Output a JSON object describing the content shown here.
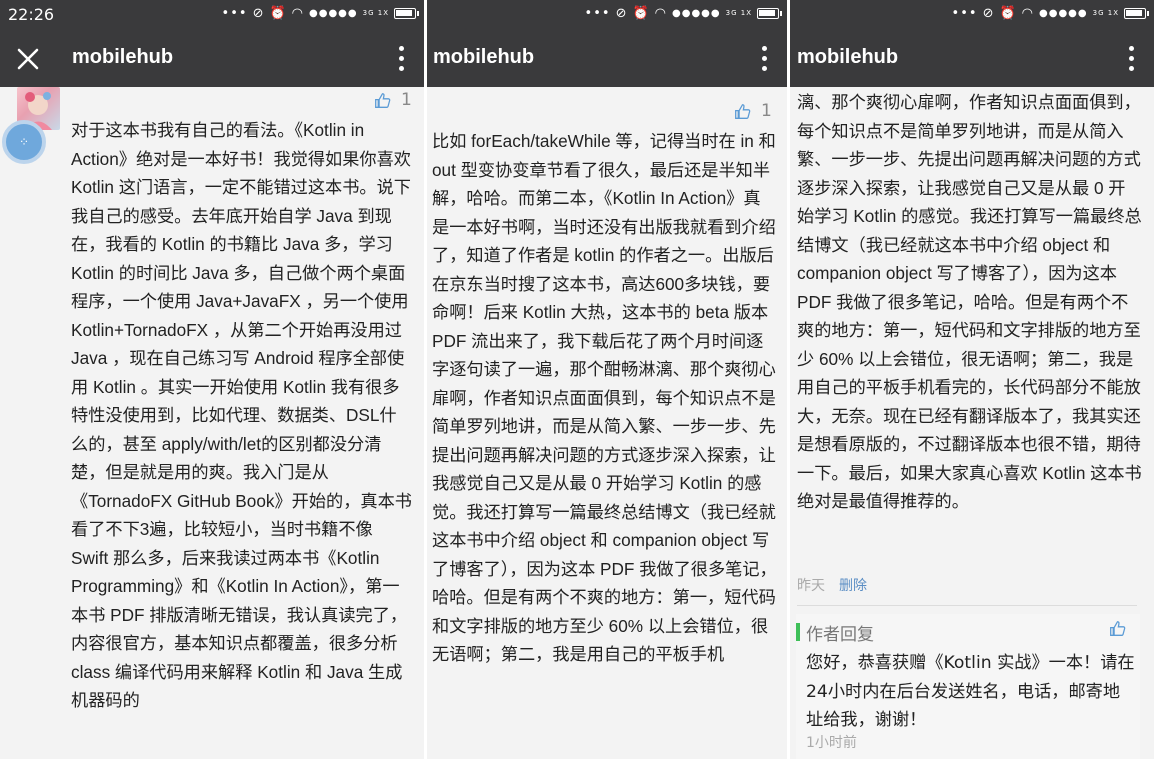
{
  "status": {
    "time": "22:26",
    "network_label": "3G 1X"
  },
  "app": {
    "title": "mobilehub"
  },
  "panel1": {
    "like_count": "1",
    "avatar_label": "avatar",
    "paragraph": "对于这本书我有自己的看法。《Kotlin in Action》绝对是一本好书！我觉得如果你喜欢 Kotlin 这门语言，一定不能错过这本书。说下我自己的感受。去年底开始自学 Java 到现在，我看的 Kotlin 的书籍比 Java 多，学习 Kotlin 的时间比 Java 多，自己做个两个桌面程序，一个使用 Java+JavaFX ，另一个使用 Kotlin+TornadoFX ，从第二个开始再没用过 Java ，现在自己练习写 Android 程序全部使用 Kotlin 。其实一开始使用 Kotlin 我有很多特性没使用到，比如代理、数据类、DSL什么的，甚至 apply/with/let的区别都没分清楚，但是就是用的爽。我入门是从《TornadoFX GitHub Book》开始的，真本书看了不下3遍，比较短小，当时书籍不像 Swift 那么多，后来我读过两本书《Kotlin Programming》和《Kotlin In Action》，第一本书 PDF 排版清晰无错误，我认真读完了，内容很官方，基本知识点都覆盖，很多分析 class 编译代码用来解释 Kotlin 和 Java 生成机器码的"
  },
  "panel2": {
    "like_count": "1",
    "paragraph": "比如 forEach/takeWhile 等，记得当时在 in 和 out 型变协变章节看了很久，最后还是半知半解，哈哈。而第二本，《Kotlin In Action》真是一本好书啊，当时还没有出版我就看到介绍了，知道了作者是 kotlin 的作者之一。出版后在京东当时搜了这本书，高达600多块钱，要命啊！后来 Kotlin 大热，这本书的 beta 版本 PDF 流出来了，我下载后花了两个月时间逐字逐句读了一遍，那个酣畅淋漓、那个爽彻心扉啊，作者知识点面面俱到，每个知识点不是简单罗列地讲，而是从简入繁、一步一步、先提出问题再解决问题的方式逐步深入探索，让我感觉自己又是从最 0 开始学习 Kotlin 的感觉。我还打算写一篇最终总结博文（我已经就这本书中介绍 object 和 companion object 写了博客了），因为这本 PDF 我做了很多笔记，哈哈。但是有两个不爽的地方：第一，短代码和文字排版的地方至少 60% 以上会错位，很无语啊；第二，我是用自己的平板手机"
  },
  "panel3": {
    "paragraph": "漓、那个爽彻心扉啊，作者知识点面面俱到，每个知识点不是简单罗列地讲，而是从简入繁、一步一步、先提出问题再解决问题的方式逐步深入探索，让我感觉自己又是从最 0 开始学习 Kotlin 的感觉。我还打算写一篇最终总结博文（我已经就这本书中介绍 object 和 companion object 写了博客了），因为这本 PDF 我做了很多笔记，哈哈。但是有两个不爽的地方：第一，短代码和文字排版的地方至少 60% 以上会错位，很无语啊；第二，我是用自己的平板手机看完的，长代码部分不能放大，无奈。现在已经有翻译版本了，我其实还是想看原版的，不过翻译版本也很不错，期待一下。最后，如果大家真心喜欢 Kotlin 这本书绝对是最值得推荐的。",
    "time": "昨天",
    "delete_label": "删除",
    "reply": {
      "label": "作者回复",
      "text": "您好，恭喜获赠《Kotlin 实战》一本！请在24小时内在后台发送姓名，电话，邮寄地址给我，谢谢！",
      "time": "1小时前"
    }
  }
}
